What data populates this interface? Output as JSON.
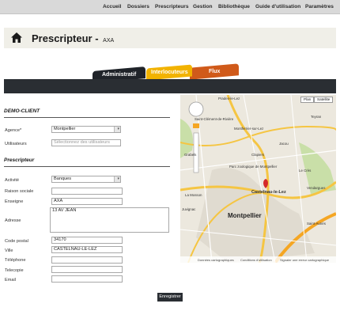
{
  "nav": {
    "items": [
      "Accueil",
      "Dossiers",
      "Prescripteurs",
      "Gestion",
      "Bibliothèque",
      "Guide d'utilisation",
      "Paramètres"
    ]
  },
  "page": {
    "title": "Prescripteur -",
    "subtitle": "AXA"
  },
  "tabs": {
    "administratif": "Administratif",
    "interlocuteurs": "Interlocuteurs",
    "flux": "Flux"
  },
  "client_section": {
    "title": "DEMO-CLIENT",
    "agence_label": "Agence*",
    "agence_value": "Montpellier",
    "utilisateurs_label": "Utilisateurs",
    "utilisateurs_placeholder": "Sélectionnez des utilisateurs"
  },
  "prescripteur_section": {
    "title": "Prescripteur",
    "activite_label": "Activité",
    "activite_value": "Banques",
    "raison_sociale_label": "Raison sociale",
    "raison_sociale_value": "",
    "enseigne_label": "Enseigne",
    "enseigne_value": "AXA",
    "adresse_label": "Adresse",
    "adresse_value": "13 AV JEAN",
    "code_postal_label": "Code postal",
    "code_postal_value": "34170",
    "ville_label": "Ville",
    "ville_value": "CASTELNAU-LE-LEZ",
    "telephone_label": "Téléphone",
    "telephone_value": "",
    "telecopie_label": "Telecopie",
    "telecopie_value": "",
    "email_label": "Email",
    "email_value": ""
  },
  "save_label": "Enregistrer",
  "map": {
    "plan_label": "Plan",
    "satellite_label": "Satellite",
    "city_main": "Montpellier",
    "city_marker": "Castelnau-le-Lez",
    "places": [
      "Prades-le-Lez",
      "Saint-Clément-de-Rivière",
      "Montferrier-sur-Lez",
      "Clapiers",
      "Jacou",
      "Teyran",
      "Le Crès",
      "Grabels",
      "Juvignac",
      "Vendargues",
      "Parc zoologique de Montpellier",
      "Saint-Aunès",
      "La Mosson"
    ],
    "footer_data": "Données cartographiques",
    "footer_terms": "Conditions d'utilisation",
    "footer_report": "Signaler une erreur cartographique",
    "colors": {
      "road_major": "#f5c542",
      "road_minor": "#ffffff",
      "urban": "#e2ddd2",
      "green": "#c9dfa8",
      "marker": "#d42a2a"
    }
  }
}
